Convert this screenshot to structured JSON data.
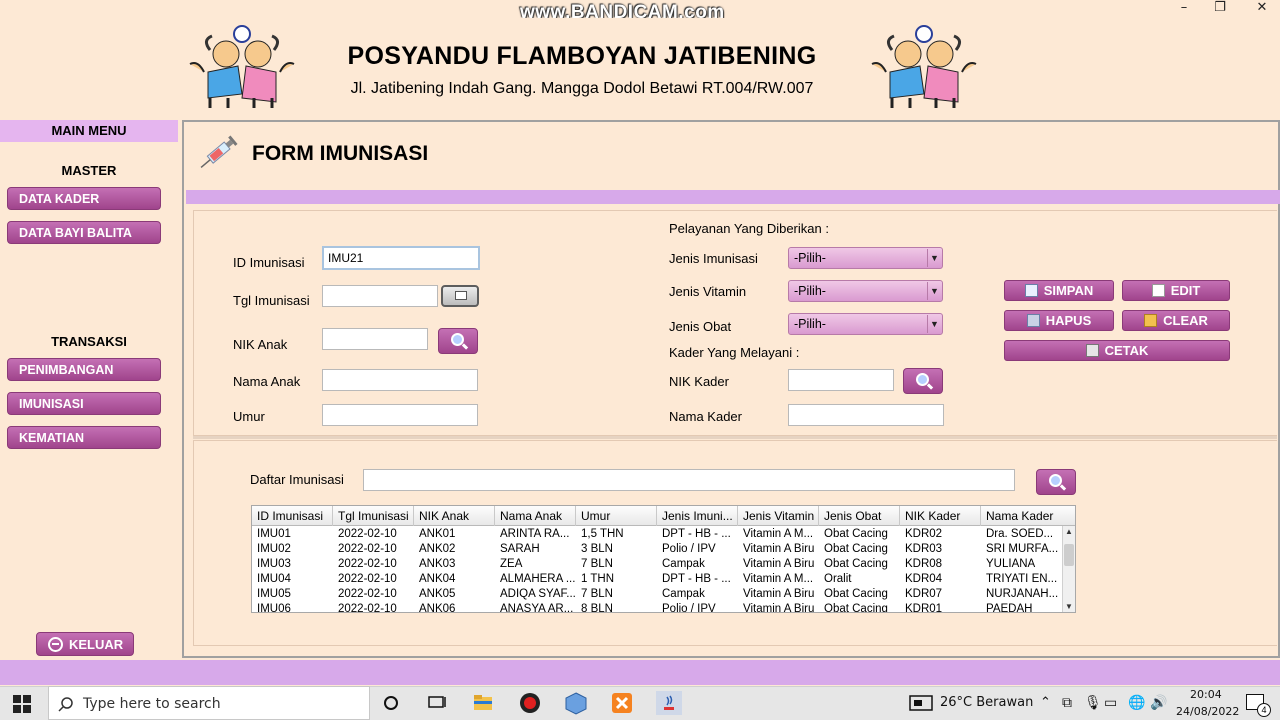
{
  "watermark": "www.BANDICAM.com",
  "window": {
    "minimize": "–",
    "maximize": "❐",
    "close": "✕"
  },
  "header": {
    "title": "POSYANDU FLAMBOYAN JATIBENING",
    "address": "Jl. Jatibening Indah Gang. Mangga Dodol Betawi RT.004/RW.007",
    "logo_icon": "children-logo-icon"
  },
  "sidebar": {
    "heading": "MAIN MENU",
    "master_label": "MASTER",
    "master_items": [
      "DATA KADER",
      "DATA BAYI BALITA"
    ],
    "transaksi_label": "TRANSAKSI",
    "transaksi_items": [
      "PENIMBANGAN",
      "IMUNISASI",
      "KEMATIAN"
    ],
    "exit_label": "KELUAR"
  },
  "form": {
    "title": "FORM IMUNISASI",
    "labels": {
      "id": "ID Imunisasi",
      "tgl": "Tgl Imunisasi",
      "nik_anak": "NIK Anak",
      "nama_anak": "Nama Anak",
      "umur": "Umur",
      "pelayanan": "Pelayanan Yang Diberikan :",
      "jenis_imunisasi": "Jenis Imunisasi",
      "jenis_vitamin": "Jenis Vitamin",
      "jenis_obat": "Jenis Obat",
      "kader": "Kader Yang Melayani :",
      "nik_kader": "NIK Kader",
      "nama_kader": "Nama Kader"
    },
    "values": {
      "id": "IMU21",
      "tgl": "",
      "nik_anak": "",
      "nama_anak": "",
      "umur": "",
      "nik_kader": "",
      "nama_kader": ""
    },
    "selects": {
      "jenis_imunisasi": "-Pilih-",
      "jenis_vitamin": "-Pilih-",
      "jenis_obat": "-Pilih-"
    },
    "buttons": {
      "simpan": "SIMPAN",
      "edit": "EDIT",
      "hapus": "HAPUS",
      "clear": "CLEAR",
      "cetak": "CETAK"
    }
  },
  "list": {
    "label": "Daftar Imunisasi",
    "search_value": "",
    "columns": [
      "ID Imunisasi",
      "Tgl Imunisasi",
      "NIK Anak",
      "Nama Anak",
      "Umur",
      "Jenis Imuni...",
      "Jenis Vitamin",
      "Jenis Obat",
      "NIK Kader",
      "Nama Kader"
    ],
    "rows": [
      [
        "IMU01",
        "2022-02-10",
        "ANK01",
        "ARINTA RA...",
        "1,5 THN",
        "DPT - HB - ...",
        "Vitamin A M...",
        "Obat Cacing",
        "KDR02",
        "Dra. SOED..."
      ],
      [
        "IMU02",
        "2022-02-10",
        "ANK02",
        "SARAH",
        "3 BLN",
        "Polio / IPV",
        "Vitamin A Biru",
        "Obat Cacing",
        "KDR03",
        "SRI MURFA..."
      ],
      [
        "IMU03",
        "2022-02-10",
        "ANK03",
        "ZEA",
        "7 BLN",
        "Campak",
        "Vitamin A Biru",
        "Obat Cacing",
        "KDR08",
        "YULIANA"
      ],
      [
        "IMU04",
        "2022-02-10",
        "ANK04",
        "ALMAHERA ...",
        "1 THN",
        "DPT - HB - ...",
        "Vitamin A M...",
        "Oralit",
        "KDR04",
        "TRIYATI EN..."
      ],
      [
        "IMU05",
        "2022-02-10",
        "ANK05",
        "ADIQA SYAF...",
        "7 BLN",
        "Campak",
        "Vitamin A Biru",
        "Obat Cacing",
        "KDR07",
        "NURJANAH..."
      ],
      [
        "IMU06",
        "2022-02-10",
        "ANK06",
        "ANASYA AR...",
        "8 BLN",
        "Polio / IPV",
        "Vitamin A Biru",
        "Obat Cacing",
        "KDR01",
        "PAEDAH"
      ]
    ]
  },
  "taskbar": {
    "search_placeholder": "Type here to search",
    "weather": "26°C  Berawan",
    "time": "20:04",
    "date": "24/08/2022",
    "notifications": "4"
  },
  "colors": {
    "accent": "#a94b96",
    "band": "#d7a9ea",
    "background": "#fde9d5"
  }
}
